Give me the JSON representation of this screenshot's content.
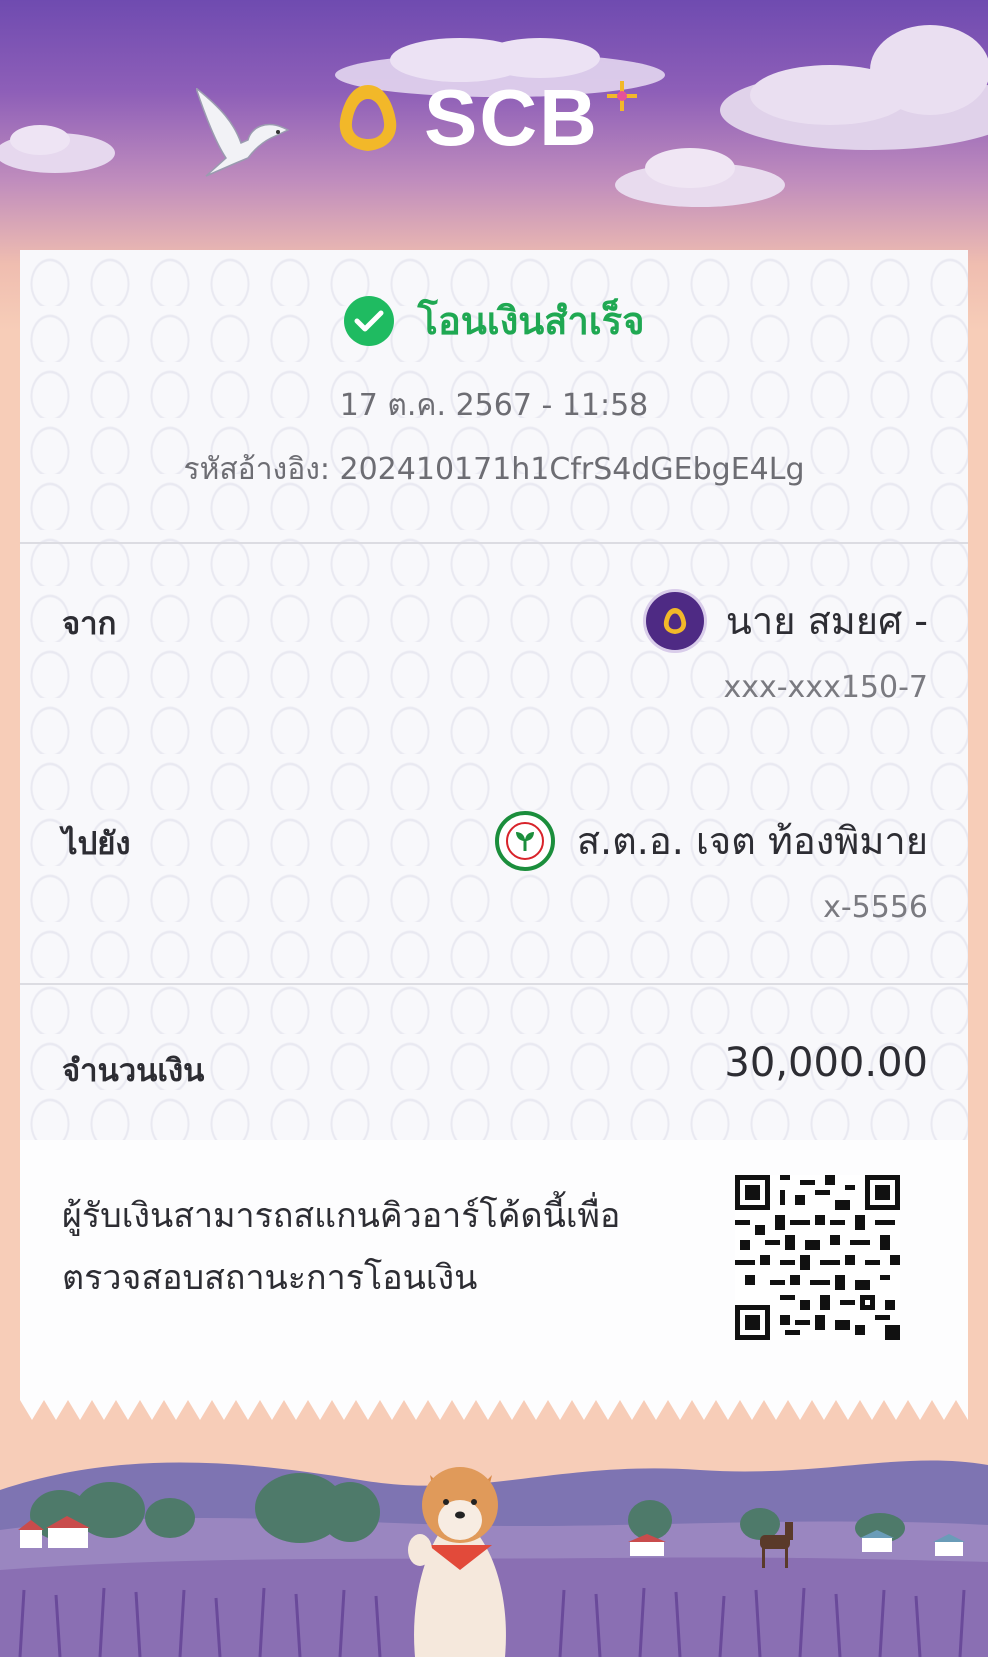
{
  "header": {
    "brand": "SCB"
  },
  "receipt": {
    "status": "โอนเงินสำเร็จ",
    "datetime": "17 ต.ค. 2567 - 11:58",
    "reference": "รหัสอ้างอิง: 202410171h1CfrS4dGEbgE4Lg",
    "from": {
      "label": "จาก",
      "name": "นาย สมยศ -",
      "account": "xxx-xxx150-7",
      "bank_icon": "scb-bank-icon",
      "bank_color": "#4e2a84"
    },
    "to": {
      "label": "ไปยัง",
      "name": "ส.ต.อ. เจต ท้องพิมาย",
      "account": "x-5556",
      "bank_icon": "kbank-bank-icon",
      "bank_color": "#1b8e3c"
    },
    "amount": {
      "label": "จำนวนเงิน",
      "value": "30,000.00"
    },
    "qr": {
      "text": "ผู้รับเงินสามารถสแกนคิวอาร์โค้ดนี้เพื่อตรวจสอบสถานะการโอนเงิน",
      "icon": "qr-code-icon"
    }
  },
  "colors": {
    "success": "#1fbb61",
    "brand_purple": "#4e2a84",
    "brand_gold": "#f2b829"
  }
}
